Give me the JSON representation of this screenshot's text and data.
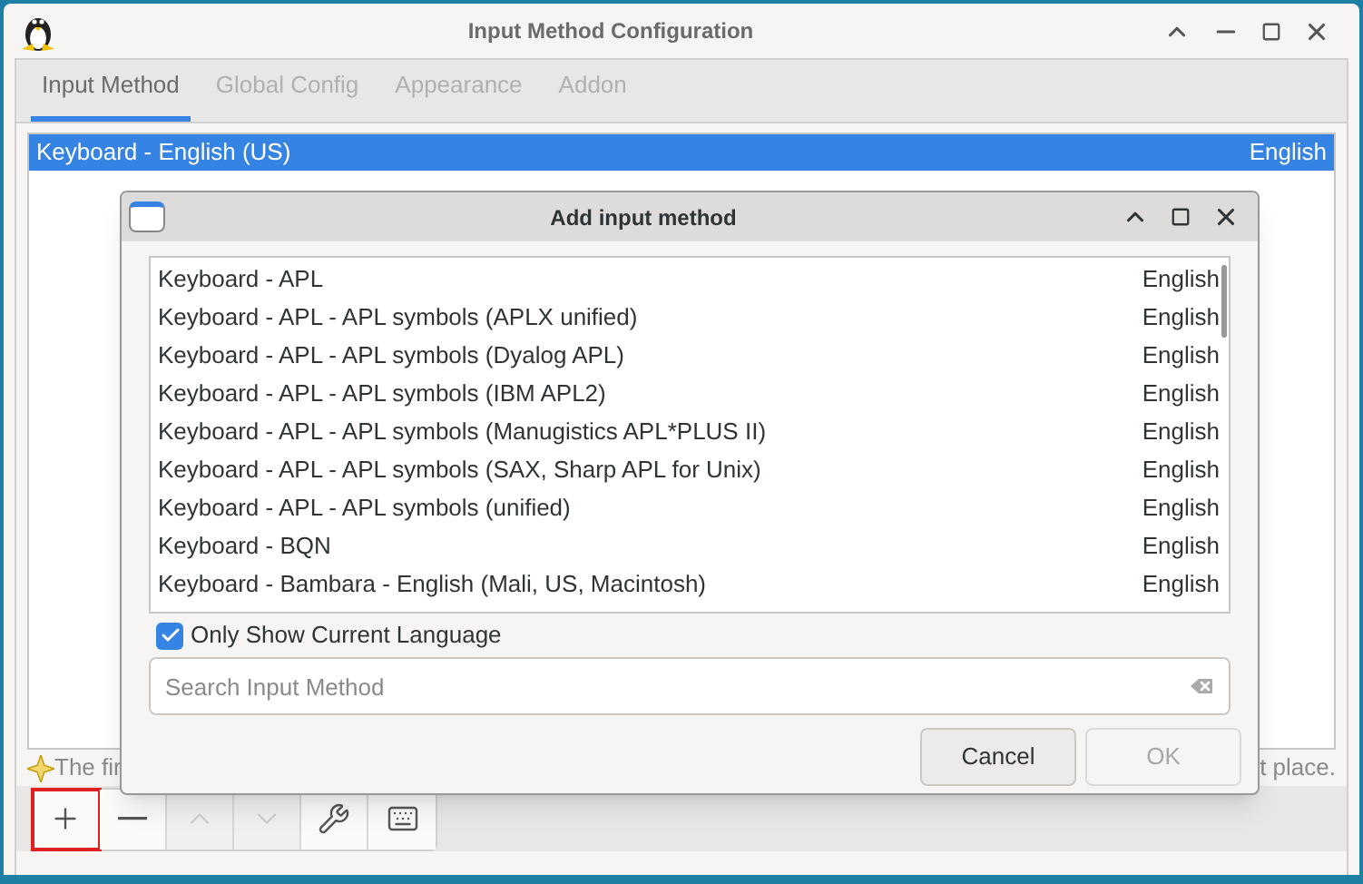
{
  "window": {
    "title": "Input Method Configuration"
  },
  "tabs": [
    {
      "label": "Input Method",
      "selected": true
    },
    {
      "label": "Global Config",
      "selected": false
    },
    {
      "label": "Appearance",
      "selected": false
    },
    {
      "label": "Addon",
      "selected": false
    }
  ],
  "current_methods": [
    {
      "name": "Keyboard - English (US)",
      "language": "English",
      "selected": true
    }
  ],
  "hint": {
    "left": "The fir",
    "right": "t place."
  },
  "toolbar": [
    {
      "kind": "add",
      "disabled": false,
      "highlighted": true
    },
    {
      "kind": "remove",
      "disabled": false,
      "highlighted": false
    },
    {
      "kind": "up",
      "disabled": true,
      "highlighted": false
    },
    {
      "kind": "down",
      "disabled": true,
      "highlighted": false
    },
    {
      "kind": "configure",
      "disabled": false,
      "highlighted": false
    },
    {
      "kind": "keyboard",
      "disabled": false,
      "highlighted": false
    }
  ],
  "dialog": {
    "title": "Add input method",
    "methods": [
      {
        "name": "Keyboard - APL",
        "language": "English"
      },
      {
        "name": "Keyboard - APL - APL symbols (APLX unified)",
        "language": "English"
      },
      {
        "name": "Keyboard - APL - APL symbols (Dyalog APL)",
        "language": "English"
      },
      {
        "name": "Keyboard - APL - APL symbols (IBM APL2)",
        "language": "English"
      },
      {
        "name": "Keyboard - APL - APL symbols (Manugistics APL*PLUS II)",
        "language": "English"
      },
      {
        "name": "Keyboard - APL - APL symbols (SAX, Sharp APL for Unix)",
        "language": "English"
      },
      {
        "name": "Keyboard - APL - APL symbols (unified)",
        "language": "English"
      },
      {
        "name": "Keyboard - BQN",
        "language": "English"
      },
      {
        "name": "Keyboard - Bambara - English (Mali, US, Macintosh)",
        "language": "English"
      }
    ],
    "only_current_language": {
      "label": "Only Show Current Language",
      "checked": true
    },
    "search": {
      "placeholder": "Search Input Method"
    },
    "buttons": [
      {
        "label": "Cancel",
        "disabled": false
      },
      {
        "label": "OK",
        "disabled": true
      }
    ]
  }
}
